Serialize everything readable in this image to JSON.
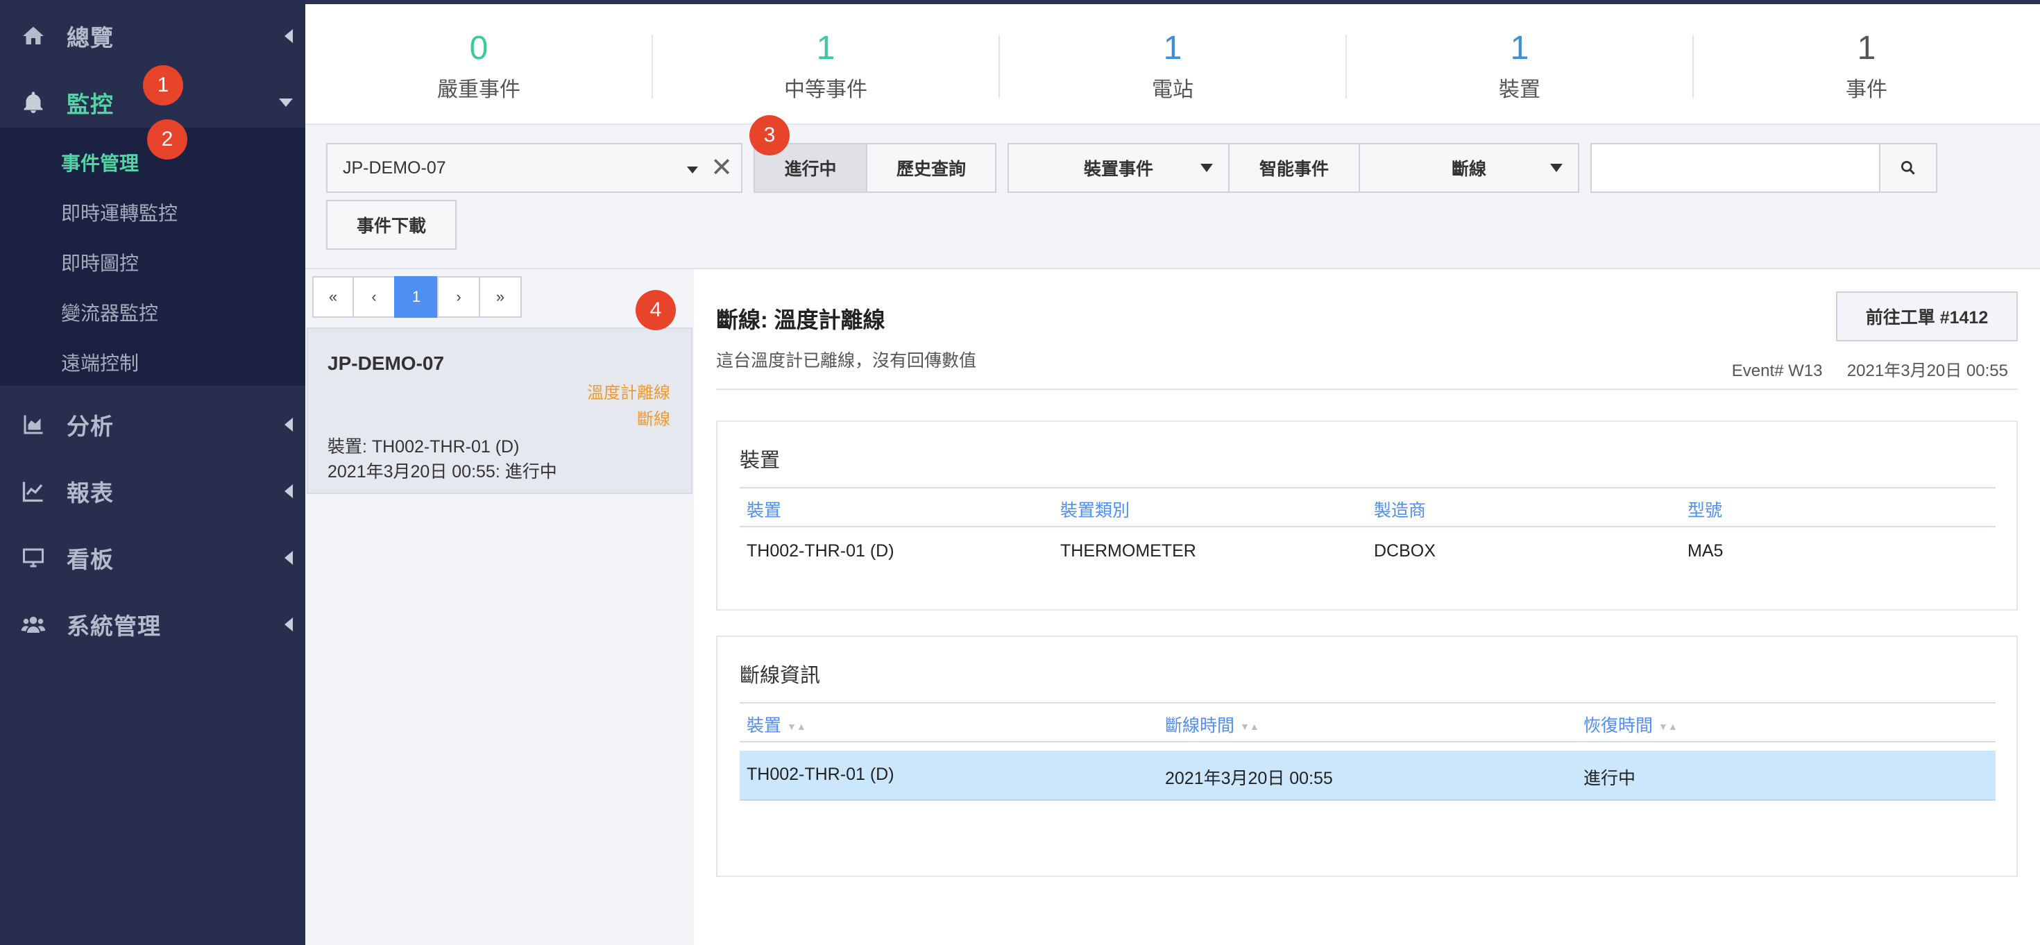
{
  "sidebar": {
    "items": [
      {
        "label": "總覽",
        "icon": "home-icon"
      },
      {
        "label": "監控",
        "icon": "bell-icon"
      },
      {
        "label": "分析",
        "icon": "area-chart-icon"
      },
      {
        "label": "報表",
        "icon": "line-chart-icon"
      },
      {
        "label": "看板",
        "icon": "monitor-icon"
      },
      {
        "label": "系統管理",
        "icon": "users-icon"
      }
    ],
    "submenu": [
      "事件管理",
      "即時運轉監控",
      "即時圖控",
      "變流器監控",
      "遠端控制"
    ]
  },
  "badges": [
    "1",
    "2",
    "3",
    "4"
  ],
  "stats": [
    {
      "value": "0",
      "label": "嚴重事件",
      "color": "#3ec99b"
    },
    {
      "value": "1",
      "label": "中等事件",
      "color": "#3ec99b"
    },
    {
      "value": "1",
      "label": "電站",
      "color": "#3f8fd6"
    },
    {
      "value": "1",
      "label": "裝置",
      "color": "#3f8fd6"
    },
    {
      "value": "1",
      "label": "事件",
      "color": "#555555"
    }
  ],
  "filters": {
    "site": "JP-DEMO-07",
    "clear_icon": "close-icon",
    "ongoing": "進行中",
    "history": "歷史查詢",
    "device_event": "裝置事件",
    "smart_event": "智能事件",
    "disconnect": "斷線",
    "search_placeholder": "",
    "download": "事件下載"
  },
  "pagination": [
    "«",
    "‹",
    "1",
    "›",
    "»"
  ],
  "event_card": {
    "site": "JP-DEMO-07",
    "tag1": "溫度計離線",
    "tag2": "斷線",
    "device": "裝置: TH002-THR-01 (D)",
    "time_status": "2021年3月20日 00:55: 進行中"
  },
  "detail": {
    "title": "斷線: 溫度計離線",
    "description": "這台溫度計已離線，沒有回傳數值",
    "work_order_button": "前往工單 #1412",
    "event_no": "Event# W13",
    "event_time": "2021年3月20日 00:55",
    "device_panel": {
      "title": "裝置",
      "headers": [
        "裝置",
        "裝置類別",
        "製造商",
        "型號"
      ],
      "row": [
        "TH002-THR-01 (D)",
        "THERMOMETER",
        "DCBOX",
        "MA5"
      ]
    },
    "disconnect_panel": {
      "title": "斷線資訊",
      "headers": [
        "裝置",
        "斷線時間",
        "恢復時間"
      ],
      "row": [
        "TH002-THR-01 (D)",
        "2021年3月20日 00:55",
        "進行中"
      ]
    }
  }
}
